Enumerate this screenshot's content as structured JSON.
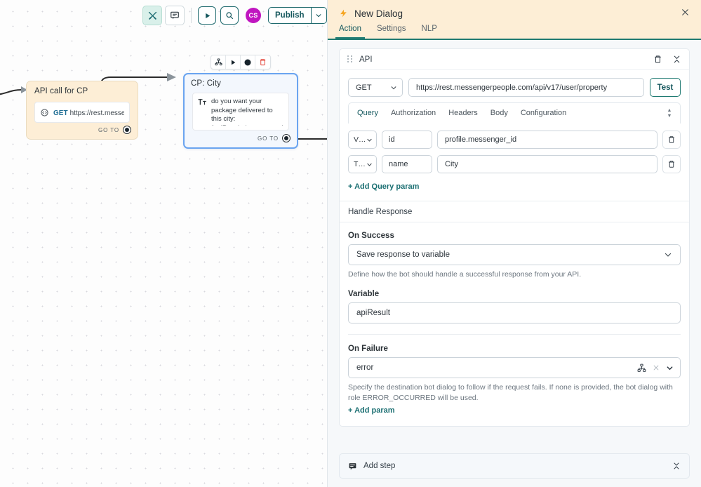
{
  "canvas": {
    "toolbar": {
      "tools_icon": "tools-icon",
      "comment_icon": "comment-icon",
      "play_icon": "play-icon",
      "search_icon": "search-icon",
      "avatar_initials": "CS",
      "avatar_color": "#c016c0",
      "publish_label": "Publish",
      "publish_caret_icon": "chevron-down-icon"
    },
    "node_toolbar": {
      "sitemap_icon": "sitemap-icon",
      "play_icon": "play-icon",
      "record_icon": "filled-circle-icon",
      "delete_icon": "trash-icon",
      "delete_color": "#e23b2e"
    },
    "nodes": [
      {
        "title": "API call for CP",
        "icon": "api-gear-icon",
        "method": "GET",
        "url": "https://rest.messenge…",
        "goto_label": "GO TO",
        "accent": "#fdeed6"
      },
      {
        "title": "CP: City",
        "icon": "text-format-icon",
        "text": "do you want your package delivered to this city: {apiResult.data.user_values[…",
        "goto_label": "GO TO",
        "accent": "#f3f7fd",
        "selected": true
      }
    ]
  },
  "panel": {
    "header": {
      "bolt_icon": "lightning-bolt-icon",
      "title": "New Dialog",
      "close_icon": "close-icon",
      "accent_color": "#1f7a72",
      "background": "#fdeed6"
    },
    "tabs": [
      {
        "label": "Action",
        "active": true
      },
      {
        "label": "Settings",
        "active": false
      },
      {
        "label": "NLP",
        "active": false
      }
    ],
    "api_card": {
      "grip_icon": "drag-handle-icon",
      "title": "API",
      "delete_icon": "trash-icon",
      "collapse_icon": "collapse-icon",
      "method": {
        "value": "GET",
        "caret_icon": "chevron-down-icon"
      },
      "url": {
        "value": "https://rest.messengerpeople.com/api/v17/user/property",
        "placeholder": "https://"
      },
      "test_label": "Test",
      "subtabs": [
        {
          "label": "Query",
          "active": true
        },
        {
          "label": "Authorization",
          "active": false
        },
        {
          "label": "Headers",
          "active": false
        },
        {
          "label": "Body",
          "active": false
        },
        {
          "label": "Configuration",
          "active": false
        }
      ],
      "spinner": {
        "up_icon": "caret-up-icon",
        "down_icon": "caret-down-icon"
      },
      "query_params": [
        {
          "type": "V…",
          "type_caret_icon": "chevron-down-icon",
          "key": "id",
          "value": "profile.messenger_id",
          "delete_icon": "trash-icon"
        },
        {
          "type": "T…",
          "type_caret_icon": "chevron-down-icon",
          "key": "name",
          "value": "City",
          "delete_icon": "trash-icon"
        }
      ],
      "add_query_param_label": "+ Add Query param",
      "handle_response": {
        "section_title": "Handle Response",
        "on_success_label": "On Success",
        "on_success_value": "Save response to variable",
        "on_success_caret_icon": "chevron-down-icon",
        "on_success_helper": "Define how the bot should handle a successful response from your API.",
        "variable_label": "Variable",
        "variable_value": "apiResult",
        "on_failure_label": "On Failure",
        "on_failure_value": "error",
        "on_failure_sitemap_icon": "sitemap-icon",
        "on_failure_clear_icon": "clear-x-icon",
        "on_failure_caret_icon": "chevron-down-icon",
        "on_failure_helper": "Specify the destination bot dialog to follow if the request fails. If none is provided, the bot dialog with role ERROR_OCCURRED will be used.",
        "add_param_label": "+ Add param"
      }
    },
    "add_step": {
      "icon": "step-message-icon",
      "label": "Add step",
      "collapse_icon": "collapse-icon"
    }
  }
}
